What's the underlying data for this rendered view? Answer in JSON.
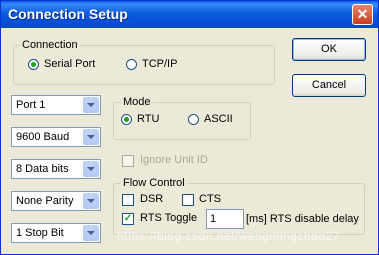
{
  "window": {
    "title": "Connection Setup",
    "close_glyph": "✕"
  },
  "buttons": {
    "ok": "OK",
    "cancel": "Cancel"
  },
  "connection": {
    "label": "Connection",
    "serial": "Serial Port",
    "tcpip": "TCP/IP",
    "selected": "Serial Port"
  },
  "port_settings": {
    "port": "Port 1",
    "baud": "9600 Baud",
    "data_bits": "8 Data bits",
    "parity": "None Parity",
    "stop_bits": "1 Stop Bit"
  },
  "mode": {
    "label": "Mode",
    "rtu": "RTU",
    "ascii": "ASCII",
    "selected": "RTU"
  },
  "ignore_unit_id": {
    "label": "Ignore Unit ID",
    "checked": false,
    "disabled": true
  },
  "flow_control": {
    "label": "Flow Control",
    "dsr": "DSR",
    "cts": "CTS",
    "rts_toggle": "RTS Toggle",
    "rts_toggle_checked": true,
    "rts_delay_value": "1",
    "rts_delay_label": "[ms] RTS disable delay"
  },
  "watermark": "https://blog.csdn.net/wangmingchao27"
}
